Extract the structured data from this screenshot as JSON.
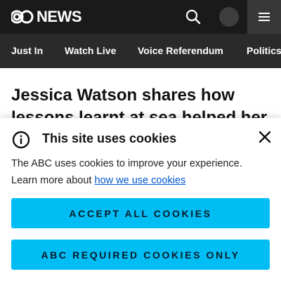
{
  "header": {
    "logo_text": "NEWS",
    "logo_icon": "abc-logo-icon",
    "search_icon": "search-icon",
    "profile_icon": "profile-avatar",
    "menu_icon": "hamburger-menu-icon",
    "colors": {
      "topbar": "#1a1a1a",
      "nav": "#2a2a2a",
      "menu_bg": "#383838"
    }
  },
  "nav": {
    "items": [
      {
        "label": "Just In"
      },
      {
        "label": "Watch Live"
      },
      {
        "label": "Voice Referendum"
      },
      {
        "label": "Politics"
      }
    ]
  },
  "article": {
    "headline": "Jessica Watson shares how lessons learnt at sea helped her"
  },
  "cookie_banner": {
    "title": "This site uses cookies",
    "body_text": "The ABC uses cookies to improve your experience. Learn more about ",
    "link_text": "how we use cookies",
    "accept_all_label": "ACCEPT ALL COOKIES",
    "required_only_label": "ABC REQUIRED COOKIES ONLY",
    "colors": {
      "button": "#00bef4",
      "link": "#0058cc"
    }
  }
}
